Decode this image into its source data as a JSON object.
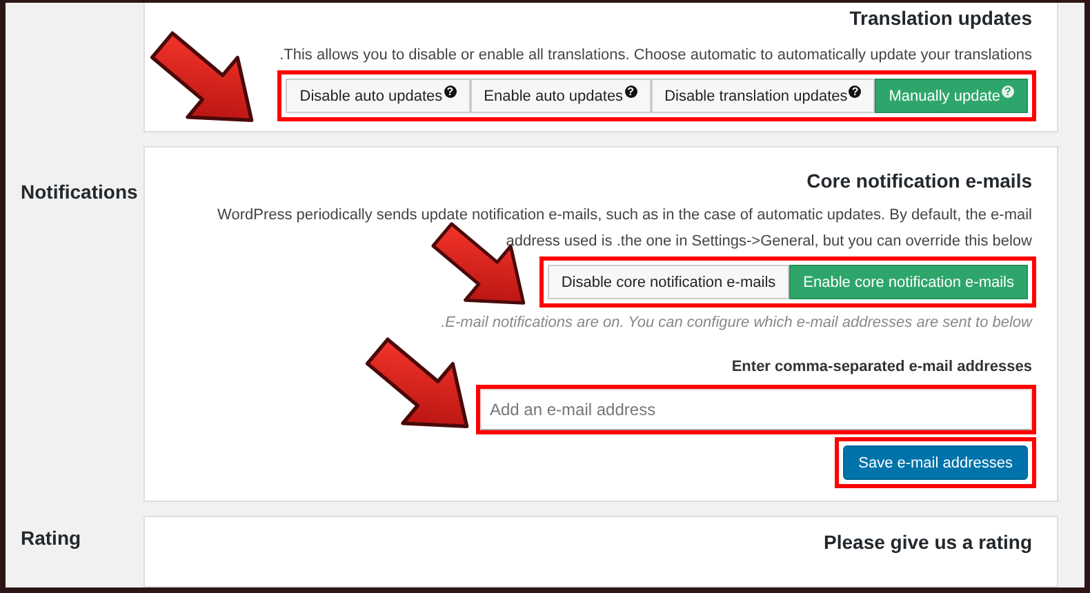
{
  "sections": [
    {
      "cards": [
        {
          "title": "Translation updates",
          "description": ".This allows you to disable or enable all translations. Choose automatic to automatically update your translations",
          "button_group": {
            "highlighted": true,
            "arrow": true,
            "buttons": [
              {
                "label": "Disable auto updates",
                "help": "?",
                "selected": false
              },
              {
                "label": "Enable auto updates",
                "help": "?",
                "selected": false
              },
              {
                "label": "Disable translation updates",
                "help": "?",
                "selected": false
              },
              {
                "label": "Manually update",
                "help": "?",
                "selected": true
              }
            ]
          }
        }
      ]
    },
    {
      "label": "Notifications",
      "cards": [
        {
          "title": "Core notification e-mails",
          "description": "WordPress periodically sends update notification e-mails, such as in the case of automatic updates. By default, the e-mail address used is .the one in Settings->General, but you can override this below",
          "button_group": {
            "highlighted": true,
            "arrow": true,
            "buttons": [
              {
                "label": "Disable core notification e-mails",
                "selected": false
              },
              {
                "label": "Enable core notification e-mails",
                "selected": true
              }
            ]
          },
          "note": ".E-mail notifications are on. You can configure which e-mail addresses are sent to below",
          "field_label": "Enter comma-separated e-mail addresses",
          "field": {
            "placeholder": "Add an e-mail address",
            "highlighted": true,
            "arrow": true
          },
          "save_button": {
            "label": "Save e-mail addresses",
            "highlighted": true
          }
        }
      ]
    },
    {
      "label": "Rating",
      "cards": [
        {
          "title": "Please give us a rating"
        }
      ]
    }
  ]
}
